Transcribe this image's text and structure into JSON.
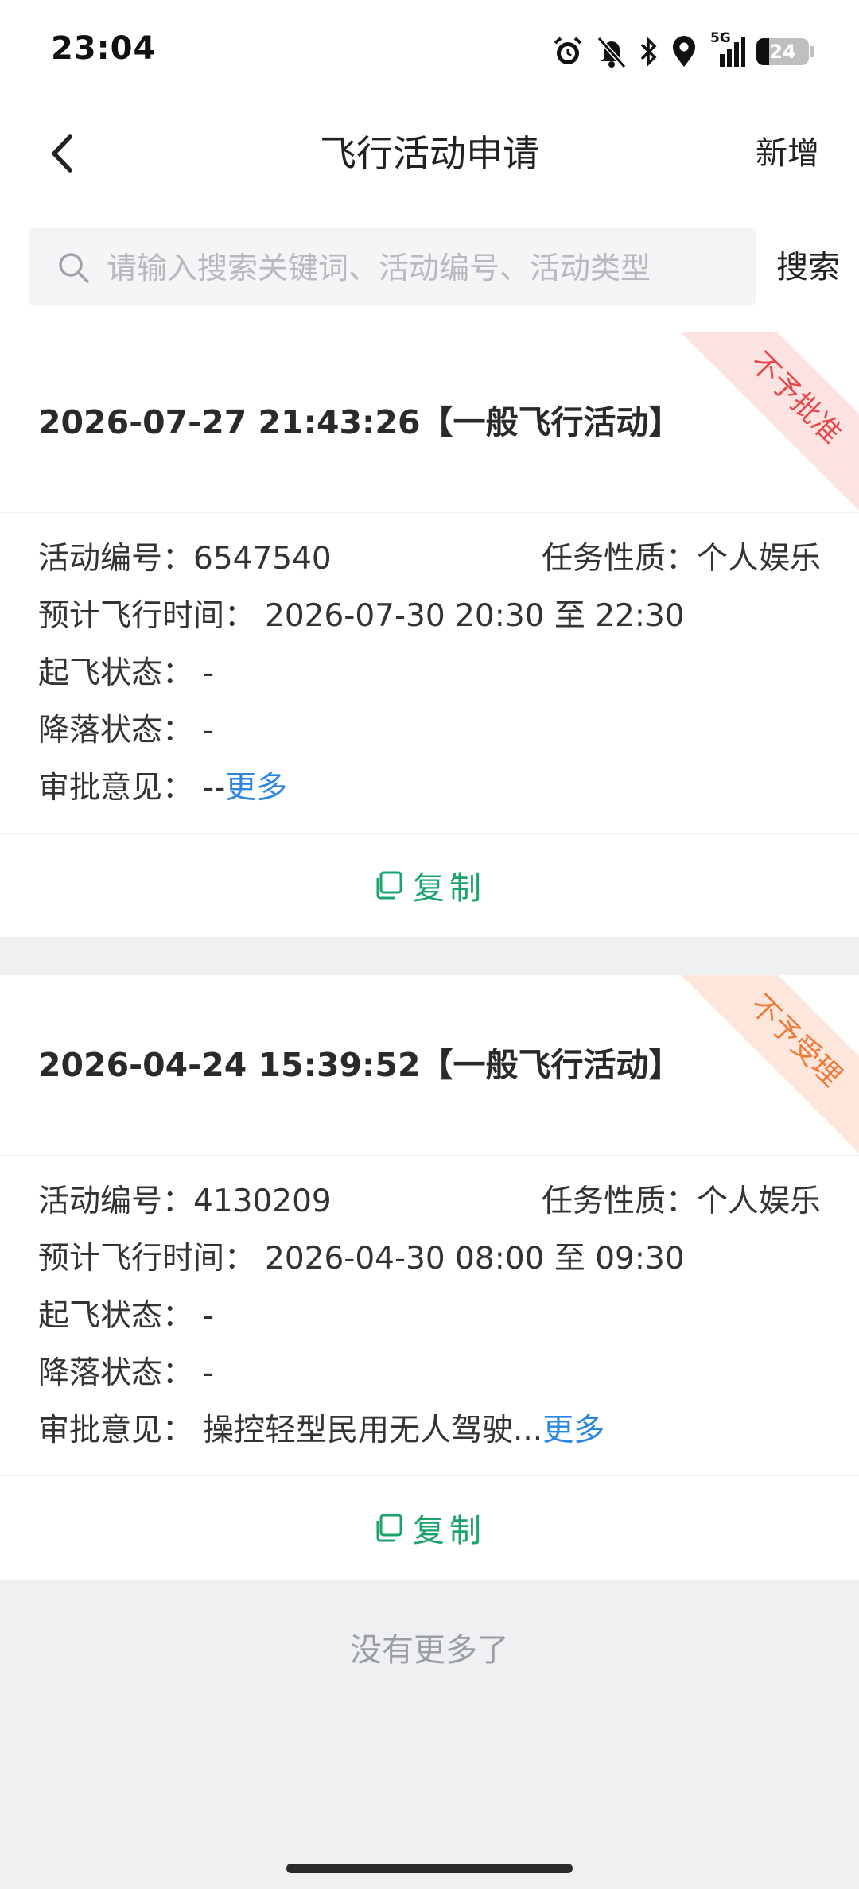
{
  "status_bar": {
    "time": "23:04",
    "network": "5G",
    "battery": "24",
    "icons": [
      "alarm-icon",
      "mute-bell-icon",
      "bluetooth-icon",
      "location-icon",
      "signal-icon",
      "battery-icon"
    ]
  },
  "nav": {
    "title": "飞行活动申请",
    "add_label": "新增",
    "back_icon": "chevron-left-icon"
  },
  "search": {
    "placeholder": "请输入搜索关键词、活动编号、活动类型",
    "value": "",
    "button_label": "搜索"
  },
  "colors": {
    "accent_green": "#1aa36b",
    "link_blue": "#2b86e0",
    "badge_rejected": "#e8474a",
    "badge_not_accepted": "#f07a3a"
  },
  "records": [
    {
      "title": "2026-07-27 21:43:26【一般飞行活动】",
      "badge": "不予批准",
      "id_label": "活动编号：",
      "id": "6547540",
      "nature_label": "任务性质：",
      "nature": "个人娱乐",
      "time_label": "预计飞行时间：",
      "time": "2026-07-30 20:30 至 22:30",
      "takeoff_label": "起飞状态：",
      "takeoff": "-",
      "landing_label": "降落状态：",
      "landing": "-",
      "opinion_label": "审批意见：",
      "opinion": "--",
      "more_label": "更多",
      "copy_label": "复制"
    },
    {
      "title": "2026-04-24 15:39:52【一般飞行活动】",
      "badge": "不予受理",
      "id_label": "活动编号：",
      "id": "4130209",
      "nature_label": "任务性质：",
      "nature": "个人娱乐",
      "time_label": "预计飞行时间：",
      "time": "2026-04-30 08:00 至 09:30",
      "takeoff_label": "起飞状态：",
      "takeoff": "-",
      "landing_label": "降落状态：",
      "landing": "-",
      "opinion_label": "审批意见：",
      "opinion": "操控轻型民用无人驾驶...",
      "more_label": "更多",
      "copy_label": "复制"
    }
  ],
  "footer": {
    "no_more": "没有更多了"
  }
}
